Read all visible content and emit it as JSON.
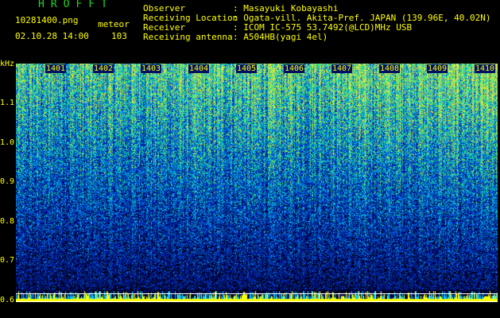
{
  "header": {
    "brand": "HROFFT",
    "filename": "10281400.png",
    "mode_label": "meteor",
    "datetime": "02.10.28 14:00",
    "count": "103",
    "fields": [
      {
        "label": "Observer",
        "value": ": Masayuki Kobayashi"
      },
      {
        "label": "Receiving Location",
        "value": ": Ogata-vill. Akita-Pref. JAPAN (139.96E, 40.02N)"
      },
      {
        "label": "Receiver",
        "value": ": ICOM IC-575 53.7492(@LCD)MHz USB"
      },
      {
        "label": "Receiving antenna",
        "value": ": A504HB(yagi 4el)"
      }
    ]
  },
  "spectrogram": {
    "y_unit": "kHz",
    "y_ticks": [
      "1.1",
      "1.0",
      "0.9",
      "0.8",
      "0.7",
      "0.6"
    ],
    "minute_labels": [
      "1401",
      "1402",
      "1403",
      "1404",
      "1405",
      "1406",
      "1407",
      "1408",
      "1409",
      "1410"
    ],
    "colors": {
      "background": "#000000",
      "low": "#0a1a9a",
      "mid": "#1f5fe0",
      "high": "#22d8d0",
      "peak": "#e0e040",
      "text": "#ffff00"
    }
  }
}
